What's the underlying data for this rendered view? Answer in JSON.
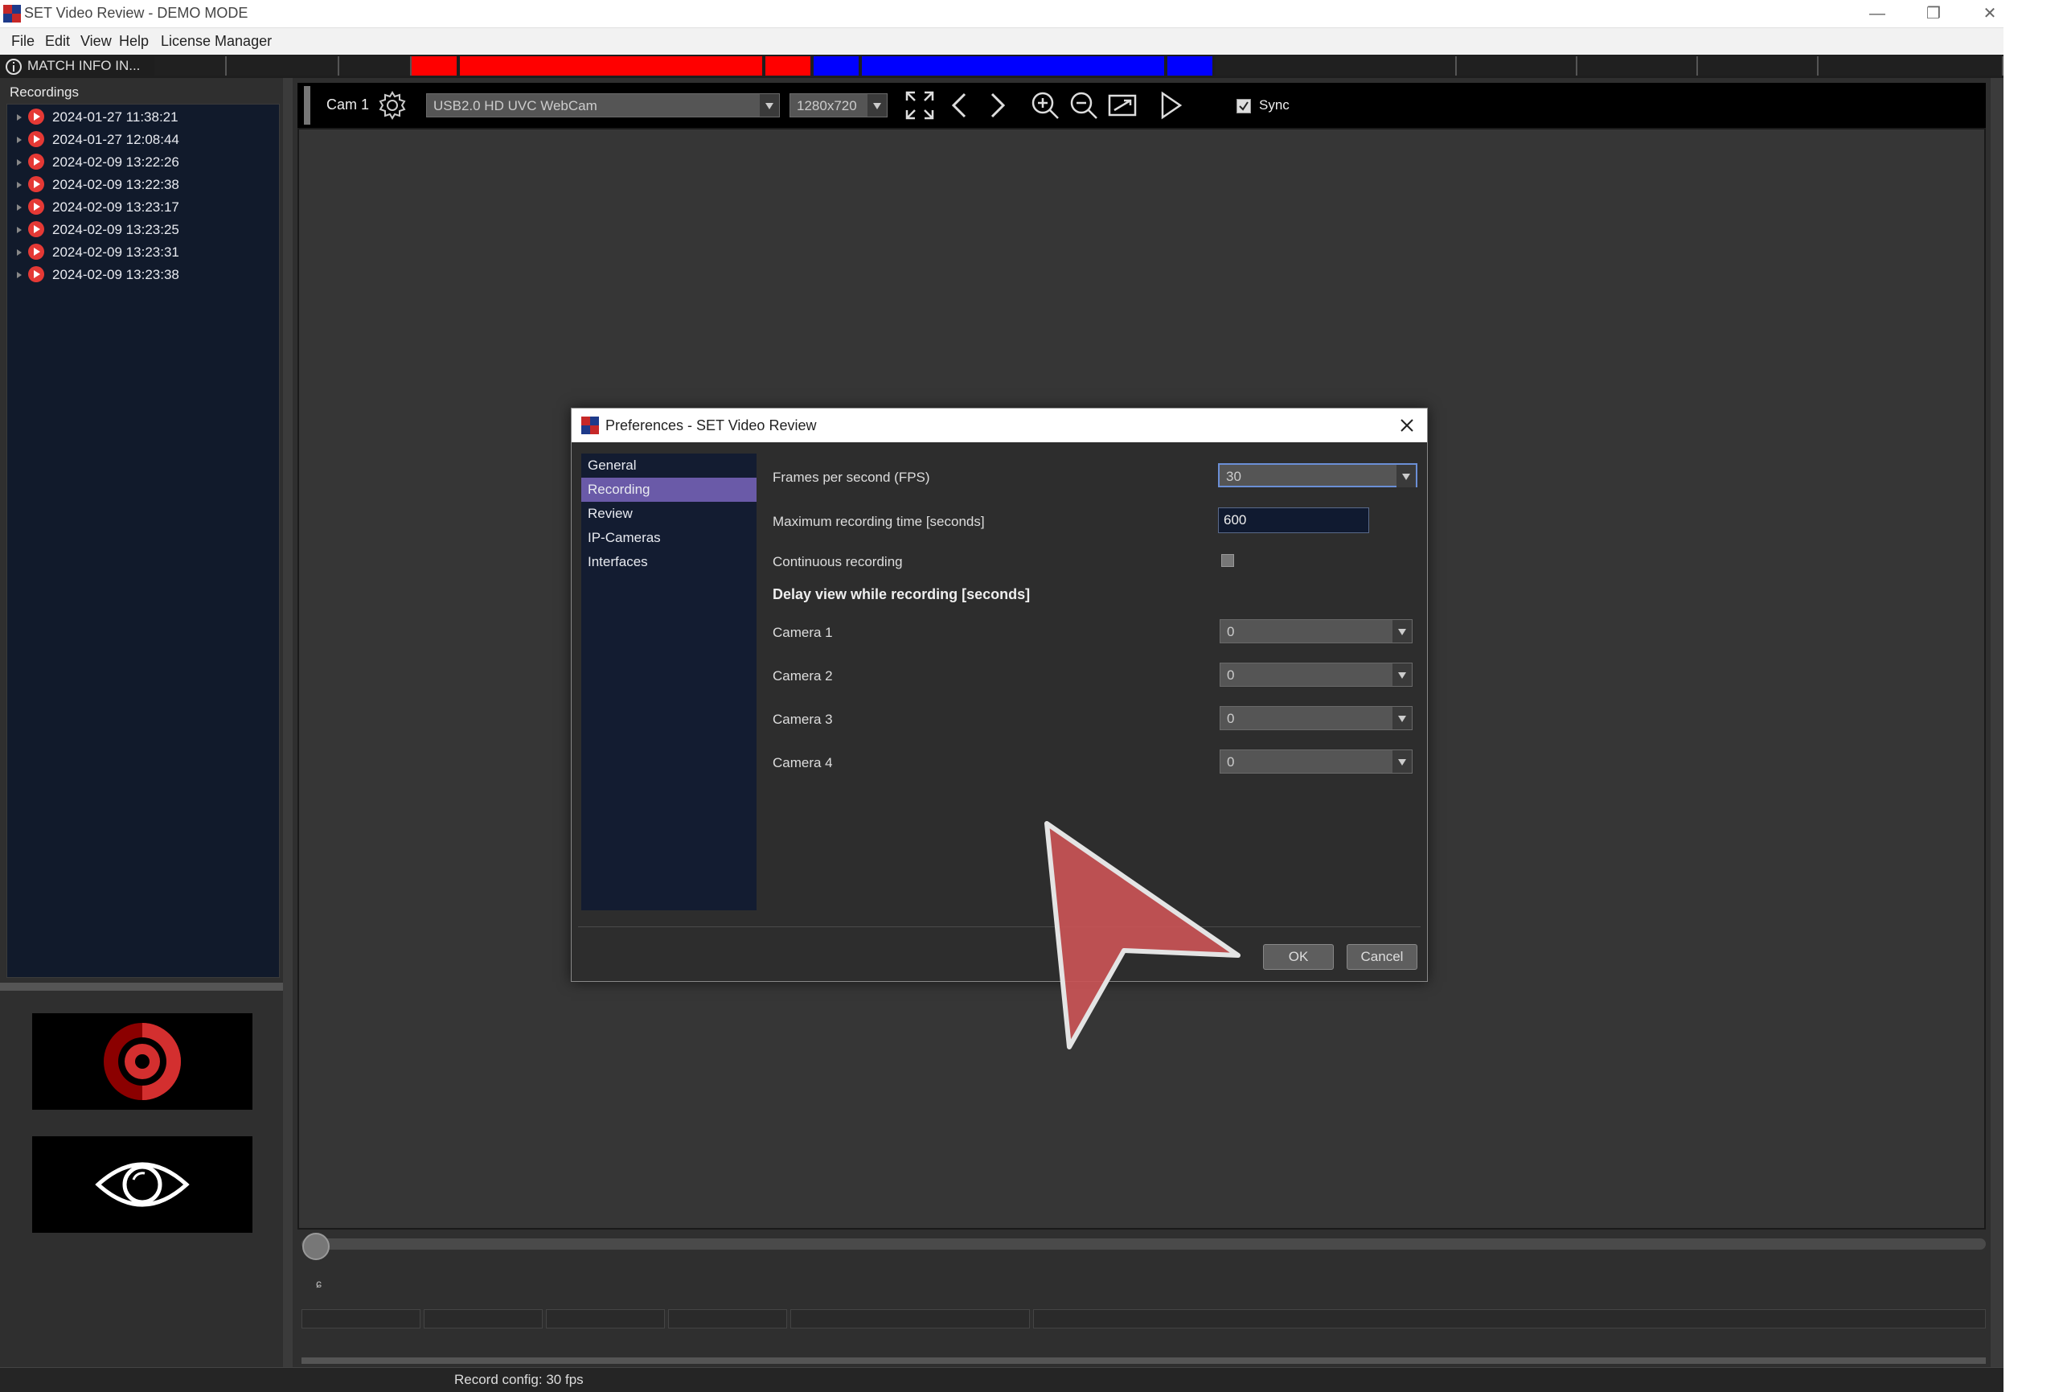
{
  "window": {
    "title": "SET Video Review - DEMO MODE",
    "minimize": "—",
    "restore": "❐",
    "close": "✕"
  },
  "menu": {
    "file": "File",
    "edit": "Edit",
    "view": "View",
    "help": "Help",
    "license": "License Manager"
  },
  "match_info": {
    "label": "MATCH INFO IN..."
  },
  "recordings": {
    "heading": "Recordings",
    "items": [
      "2024-01-27 11:38:21",
      "2024-01-27 12:08:44",
      "2024-02-09 13:22:26",
      "2024-02-09 13:22:38",
      "2024-02-09 13:23:17",
      "2024-02-09 13:23:25",
      "2024-02-09 13:23:31",
      "2024-02-09 13:23:38"
    ]
  },
  "camera_toolbar": {
    "cam_label": "Cam 1",
    "device": "USB2.0 HD UVC WebCam",
    "resolution": "1280x720",
    "sync_label": "Sync",
    "sync_checked": true
  },
  "timeline": {
    "marker": "ɕ"
  },
  "status": {
    "record_config": "Record config: 30 fps"
  },
  "dialog": {
    "title": "Preferences - SET Video Review",
    "nav": [
      "General",
      "Recording",
      "Review",
      "IP-Cameras",
      "Interfaces"
    ],
    "selected_nav": "Recording",
    "fps_label": "Frames per second (FPS)",
    "fps_value": "30",
    "max_time_label": "Maximum recording time [seconds]",
    "max_time_value": "600",
    "continuous_label": "Continuous recording",
    "continuous_checked": false,
    "delay_heading": "Delay view while recording [seconds]",
    "cameras": [
      {
        "label": "Camera 1",
        "value": "0"
      },
      {
        "label": "Camera 2",
        "value": "0"
      },
      {
        "label": "Camera 3",
        "value": "0"
      },
      {
        "label": "Camera 4",
        "value": "0"
      }
    ],
    "ok_label": "OK",
    "cancel_label": "Cancel"
  },
  "colors": {
    "accent_selected": "#6a5aa8",
    "team_red": "#ff0000",
    "team_blue": "#0000ff",
    "record_dot": "#e53935"
  }
}
